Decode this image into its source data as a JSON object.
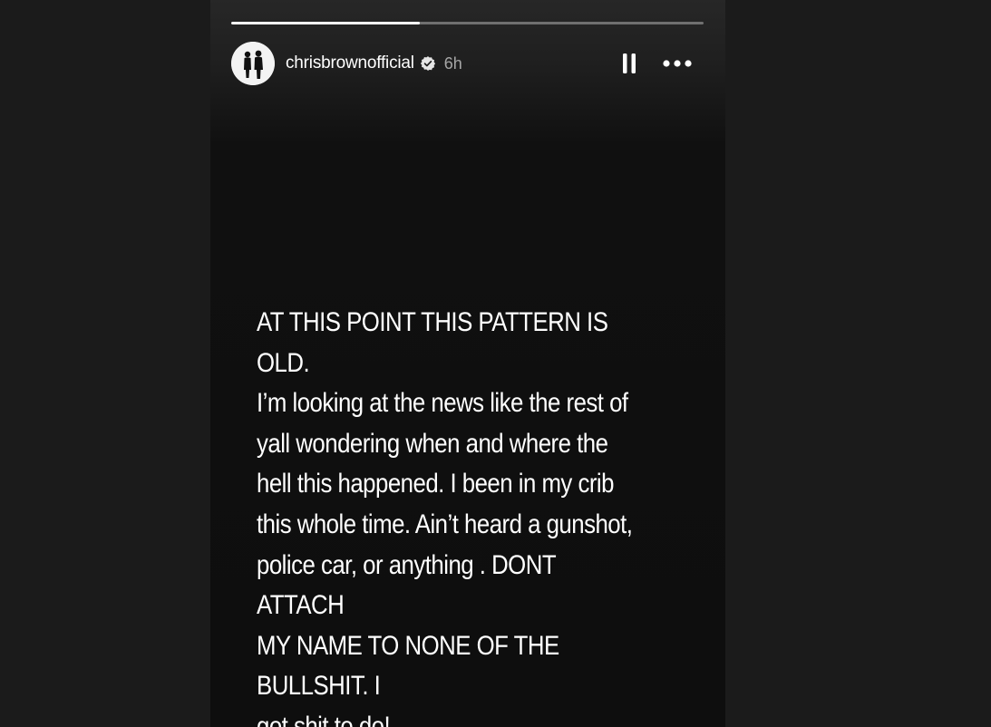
{
  "story": {
    "progress_fraction": 0.4,
    "author": {
      "username": "chrisbrownofficial",
      "verified": true,
      "posted_ago": "6h"
    },
    "controls": {
      "pause_icon": "pause-icon",
      "more_icon": "more-options-icon"
    },
    "text": "AT THIS POINT THIS PATTERN IS OLD.\nI’m looking at the news like the rest of\nyall wondering when and where the\nhell this happened. I been in my crib\nthis whole time. Ain’t heard a gunshot,\npolice car, or anything . DONT ATTACH\nMY NAME TO NONE OF THE BULLSHIT. I\ngot shit to do!"
  },
  "colors": {
    "background": "#1b1b1b",
    "story_background": "#0e0e0e",
    "text": "#ffffff",
    "muted_text": "#999999"
  }
}
